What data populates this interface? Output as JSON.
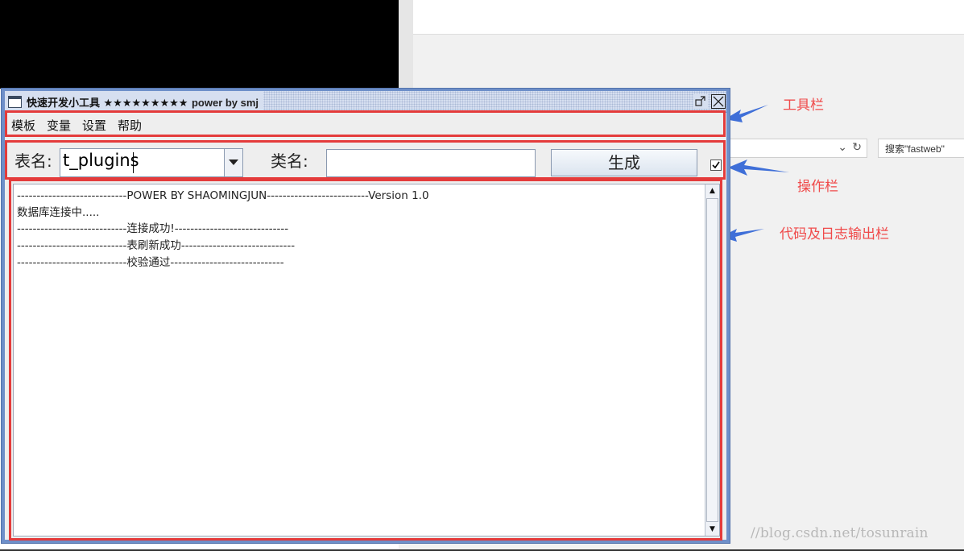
{
  "window": {
    "title": "快速开发小工具",
    "title_stars": "★★★★★★★★★",
    "title_suffix": "power by smj",
    "restore_label": "▫",
    "close_label": "☒"
  },
  "menubar": {
    "items": [
      "模板",
      "变量",
      "设置",
      "帮助"
    ]
  },
  "toolbar": {
    "table_label": "表名:",
    "table_value": "t_plugins",
    "class_label": "类名:",
    "class_value": "",
    "generate_label": "生成",
    "checkbox_checked": true
  },
  "log": {
    "lines": [
      "----------------------------POWER BY SHAOMINGJUN--------------------------Version 1.0",
      "数据库连接中.....",
      "----------------------------连接成功!-----------------------------",
      "----------------------------表刷新成功-----------------------------",
      "----------------------------校验通过-----------------------------"
    ]
  },
  "annotations": {
    "toolbar": "工具栏",
    "ops": "操作栏",
    "log": "代码及日志输出栏"
  },
  "browser": {
    "search_text": "搜索\"fastweb\"",
    "watermark": "//blog.csdn.net/tosunrain"
  },
  "colors": {
    "annotation_red": "#f04a4a",
    "arrow_blue": "#3f6fd8",
    "window_frame": "#6e8fc9"
  }
}
